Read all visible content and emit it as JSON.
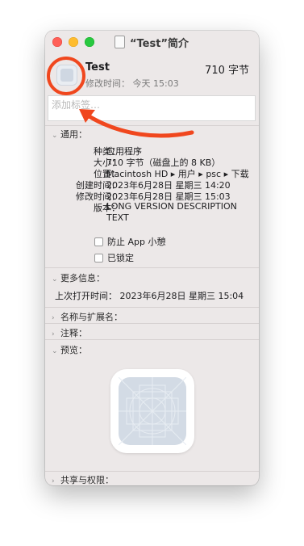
{
  "window": {
    "title": "“Test”简介"
  },
  "header": {
    "file_name": "Test",
    "file_size": "710 字节",
    "modified_line": "修改时间： 今天 15:03"
  },
  "tags": {
    "placeholder": "添加标签…"
  },
  "sections": {
    "general": "通用：",
    "more_info": "更多信息：",
    "name_ext": "名称与扩展名：",
    "comments": "注释：",
    "preview": "预览：",
    "sharing": "共享与权限："
  },
  "general": {
    "rows": [
      {
        "label": "种类：",
        "value": "应用程序"
      },
      {
        "label": "大小：",
        "value": "710 字节（磁盘上的 8 KB）"
      },
      {
        "label": "位置：",
        "value": "Macintosh HD ▸ 用户 ▸ psc ▸ 下载"
      },
      {
        "label": "创建时间：",
        "value": "2023年6月28日 星期三 14:20"
      },
      {
        "label": "修改时间：",
        "value": "2023年6月28日 星期三 15:03"
      },
      {
        "label": "版本：",
        "value": "LONG VERSION DESCRIPTION"
      }
    ],
    "version_line2": "TEXT",
    "prevent_app_nap": "防止 App 小憩",
    "locked": "已锁定"
  },
  "more_info": {
    "last_opened": "上次打开时间： 2023年6月28日 星期三 15:04"
  },
  "annotation": {
    "color": "#f0471e"
  }
}
